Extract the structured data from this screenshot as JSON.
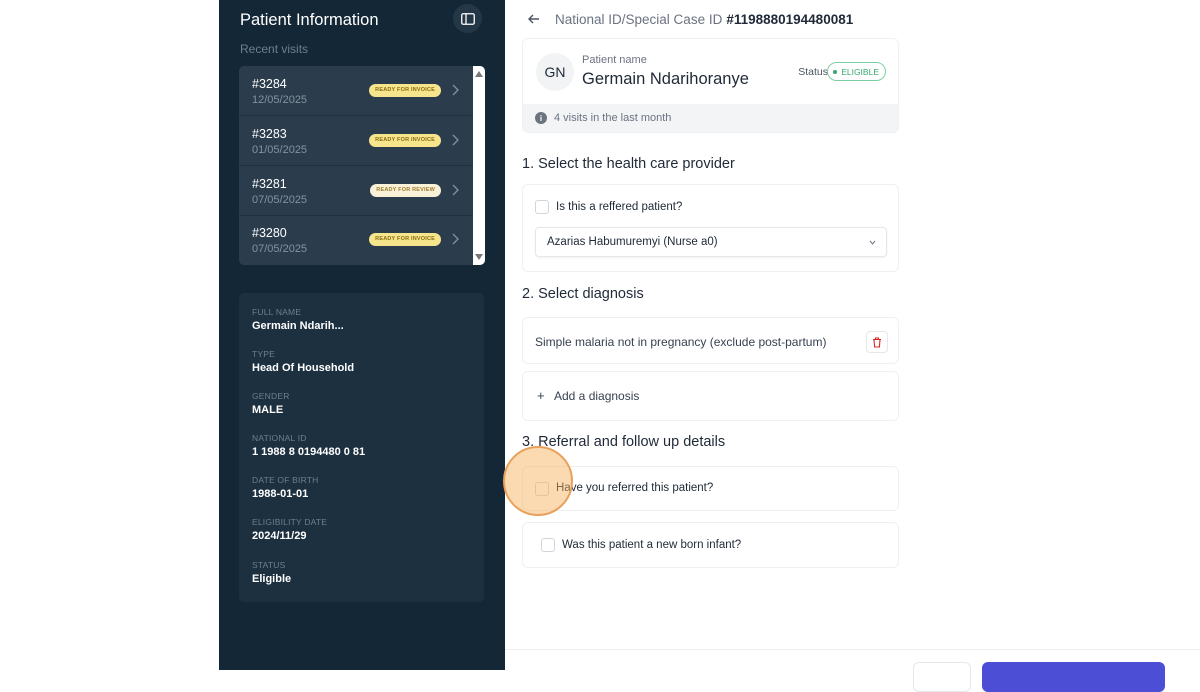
{
  "sidebar": {
    "title": "Patient Information",
    "subtitle": "Recent visits",
    "visits": [
      {
        "id": "#3284",
        "date": "12/05/2025",
        "badge": "READY FOR INVOICE",
        "badge_type": "invoice"
      },
      {
        "id": "#3283",
        "date": "01/05/2025",
        "badge": "READY FOR INVOICE",
        "badge_type": "invoice"
      },
      {
        "id": "#3281",
        "date": "07/05/2025",
        "badge": "READY FOR REVIEW",
        "badge_type": "review"
      },
      {
        "id": "#3280",
        "date": "07/05/2025",
        "badge": "READY FOR INVOICE",
        "badge_type": "invoice"
      }
    ],
    "info": [
      {
        "label": "FULL NAME",
        "value": "Germain Ndarih..."
      },
      {
        "label": "TYPE",
        "value": "Head Of Household"
      },
      {
        "label": "GENDER",
        "value": "MALE"
      },
      {
        "label": "NATIONAL ID",
        "value": "1 1988 8 0194480 0 81"
      },
      {
        "label": "DATE OF BIRTH",
        "value": "1988-01-01"
      },
      {
        "label": "ELIGIBILITY DATE",
        "value": "2024/11/29"
      },
      {
        "label": "STATUS",
        "value": "Eligible"
      }
    ]
  },
  "header": {
    "crumb_label": "National ID/Special Case ID",
    "crumb_id": "#1198880194480081"
  },
  "patient": {
    "initials": "GN",
    "name_label": "Patient name",
    "name": "Germain Ndarihoranye",
    "status_label": "Status",
    "status": "ELIGIBLE",
    "visits_note": "4 visits in the last month"
  },
  "section1": {
    "title": "1. Select the health care provider",
    "referred_label": "Is this a reffered patient?",
    "provider_value": "Azarias Habumuremyi (Nurse a0)"
  },
  "section2": {
    "title": "2. Select diagnosis",
    "diagnosis": "Simple malaria not in pregnancy (exclude post-partum)",
    "add_label": "Add a diagnosis"
  },
  "section3": {
    "title": "3. Referral and follow up details",
    "referred_q": "Have you referred this patient?",
    "newborn_q": "Was this patient a new born infant?"
  },
  "colors": {
    "sidebar_bg": "#142737",
    "accent": "#4c4fd6",
    "eligible": "#3aa670",
    "invoice_badge": "#f6e58d"
  }
}
